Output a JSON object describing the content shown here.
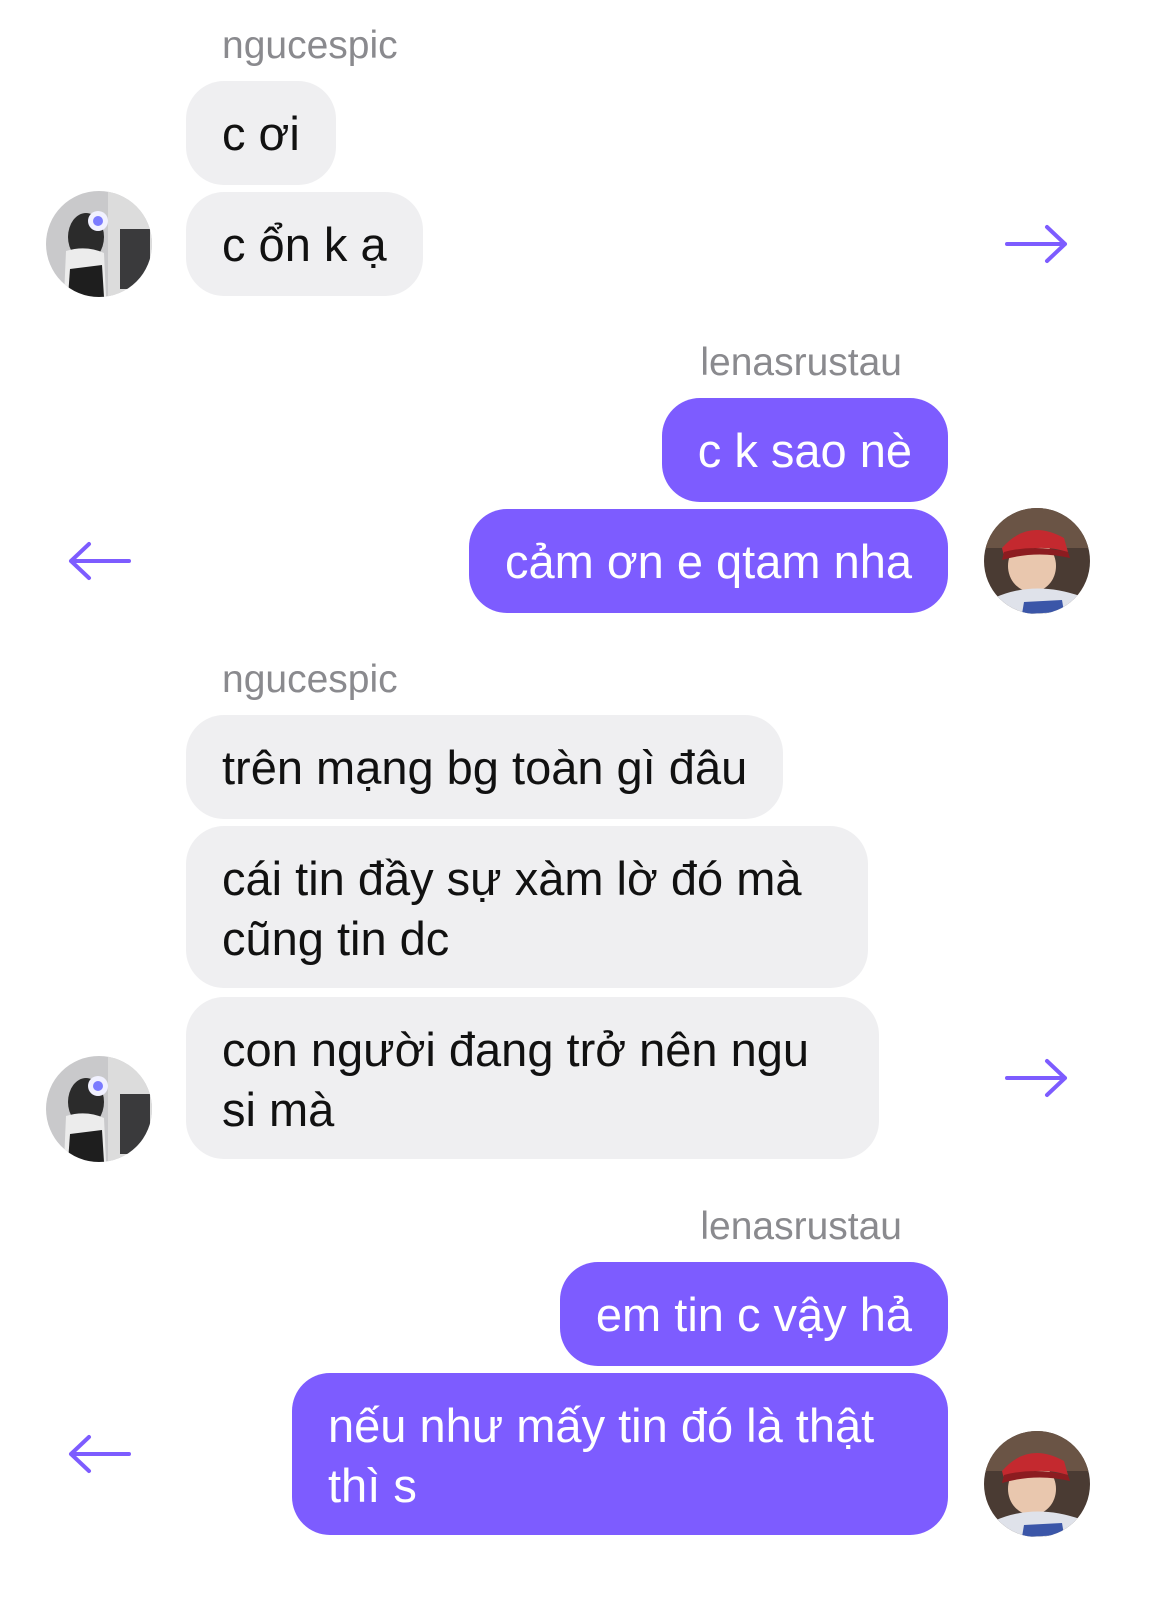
{
  "colors": {
    "accent": "#7d5cff",
    "incoming_bubble": "#efeff1",
    "sender_name": "#8a8a8e"
  },
  "groups": [
    {
      "sender": "ngucespic",
      "direction": "incoming",
      "messages": [
        "c ơi",
        "c ổn k ạ"
      ],
      "avatar": "avatar-girl-selfie",
      "arrow_icon": "arrow-right-icon"
    },
    {
      "sender": "lenasrustau",
      "direction": "outgoing",
      "messages": [
        "c k sao nè",
        "cảm ơn e qtam nha"
      ],
      "avatar": "avatar-red-cap",
      "arrow_icon": "arrow-left-icon"
    },
    {
      "sender": "ngucespic",
      "direction": "incoming",
      "messages": [
        "trên mạng bg toàn gì đâu",
        "cái tin đầy sự xàm lờ đó mà cũng tin dc",
        "con người đang trở nên ngu si mà"
      ],
      "avatar": "avatar-girl-selfie",
      "arrow_icon": "arrow-right-icon"
    },
    {
      "sender": "lenasrustau",
      "direction": "outgoing",
      "messages": [
        "em tin c vậy hả",
        "nếu như mấy tin đó là thật thì s"
      ],
      "avatar": "avatar-red-cap",
      "arrow_icon": "arrow-left-icon"
    }
  ]
}
